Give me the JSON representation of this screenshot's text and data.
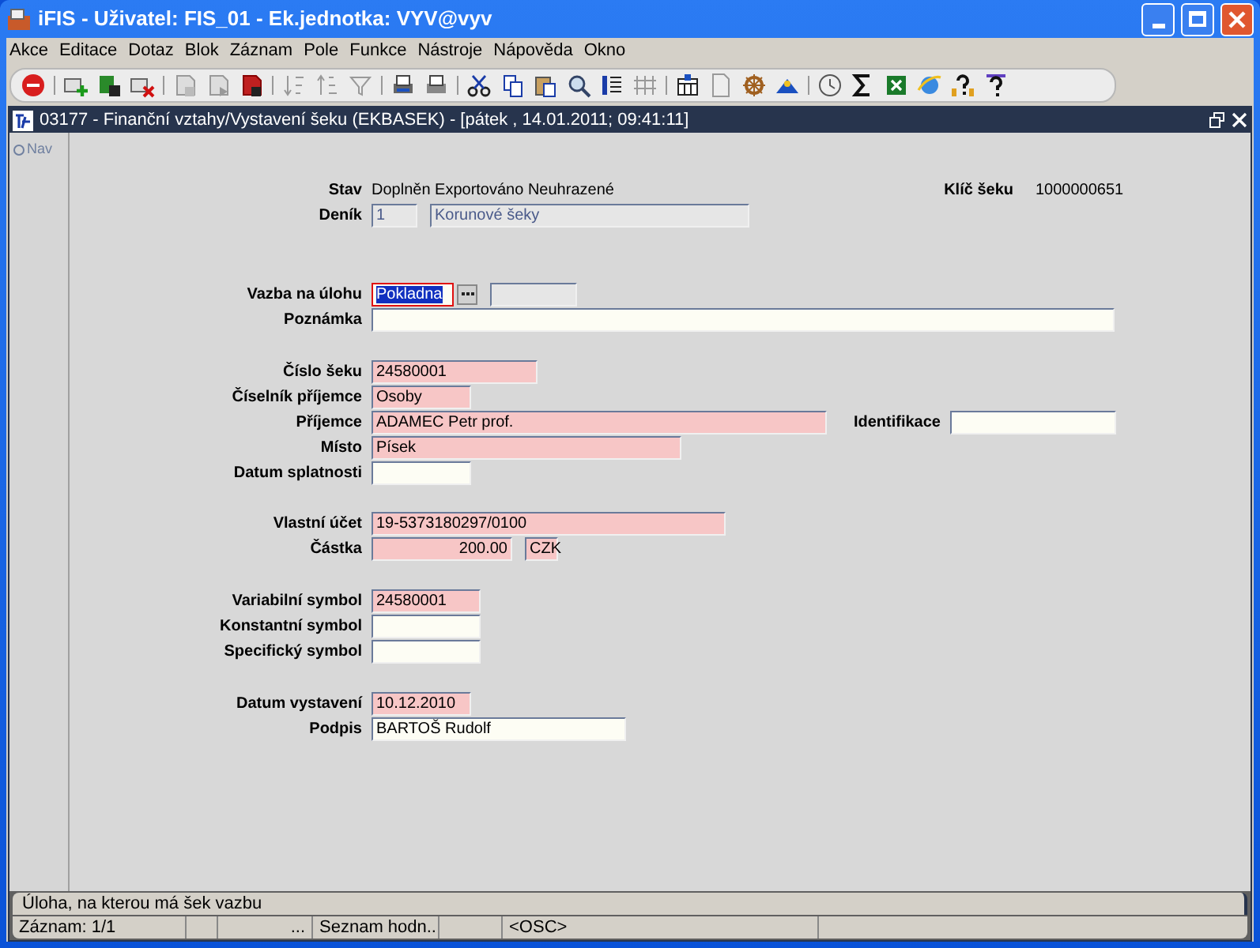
{
  "window": {
    "title": "iFIS - Uživatel: FIS_01 - Ek.jednotka: VYV@vyv"
  },
  "menu": [
    "Akce",
    "Editace",
    "Dotaz",
    "Blok",
    "Záznam",
    "Pole",
    "Funkce",
    "Nástroje",
    "Nápověda",
    "Okno"
  ],
  "frame": {
    "title": "03177 - Finanční vztahy/Vystavení šeku (EKBASEK) - [pátek  , 14.01.2011; 09:41:11]"
  },
  "nav": {
    "label": "Nav"
  },
  "form": {
    "rows": [
      {
        "kind": "status",
        "label": "Stav",
        "text": "Doplněn Exportováno Neuhrazené",
        "side_label": "Klíč šeku",
        "side_text": "1000000651"
      },
      {
        "kind": "fields",
        "label": "Deník",
        "fields": [
          {
            "kind": "text",
            "value": "1",
            "disabled": true,
            "focused": false
          },
          {
            "kind": "text",
            "value": "Korunové šeky",
            "disabled": true,
            "focused": false
          }
        ]
      },
      {
        "kind": "fields",
        "label": "Vazba na úlohu",
        "fields": [
          {
            "kind": "text",
            "value": "Pokladna",
            "required": false,
            "disabled": false,
            "focused": true
          },
          {
            "kind": "lookup"
          },
          {
            "kind": "text",
            "disabled": true,
            "focused": false
          }
        ]
      },
      {
        "kind": "fields",
        "label": "Poznámka",
        "fields": [
          {
            "kind": "text",
            "required": false,
            "disabled": false,
            "focused": false
          }
        ]
      },
      {
        "kind": "fields",
        "label": "Číslo šeku",
        "fields": [
          {
            "kind": "text",
            "value": "24580001",
            "required": true,
            "disabled": false,
            "focused": false
          }
        ]
      },
      {
        "kind": "fields",
        "label": "Číselník příjemce",
        "fields": [
          {
            "kind": "text",
            "value": "Osoby",
            "required": true,
            "disabled": false,
            "focused": false
          }
        ]
      },
      {
        "kind": "fields",
        "label": "Příjemce",
        "fields": [
          {
            "kind": "text",
            "value": "ADAMEC Petr prof.",
            "required": true,
            "disabled": false,
            "focused": false
          }
        ],
        "side_label": "Identifikace",
        "side_field": {
          "kind": "text",
          "required": false,
          "disabled": false,
          "focused": false
        }
      },
      {
        "kind": "fields",
        "label": "Místo",
        "fields": [
          {
            "kind": "text",
            "value": "Písek",
            "required": true,
            "disabled": false,
            "focused": false
          }
        ]
      },
      {
        "kind": "fields",
        "label": "Datum splatnosti",
        "fields": [
          {
            "kind": "text",
            "required": false,
            "disabled": false,
            "focused": false
          }
        ]
      },
      {
        "kind": "fields",
        "label": "Vlastní účet",
        "fields": [
          {
            "kind": "text",
            "value": "19-5373180297/0100",
            "required": true,
            "disabled": false,
            "focused": false
          }
        ]
      },
      {
        "kind": "fields",
        "label": "Částka",
        "fields": [
          {
            "kind": "amount",
            "value": "200.00",
            "required": true,
            "disabled": false,
            "focused": false
          },
          {
            "kind": "text",
            "value": "CZK",
            "required": true,
            "disabled": false,
            "focused": false
          }
        ]
      },
      {
        "kind": "fields",
        "label": "Variabilní symbol",
        "fields": [
          {
            "kind": "text",
            "value": "24580001",
            "required": true,
            "disabled": false,
            "focused": false
          }
        ]
      },
      {
        "kind": "fields",
        "label": "Konstantní symbol",
        "fields": [
          {
            "kind": "text",
            "required": false,
            "disabled": false,
            "focused": false
          }
        ]
      },
      {
        "kind": "fields",
        "label": "Specifický symbol",
        "fields": [
          {
            "kind": "text",
            "required": false,
            "disabled": false,
            "focused": false
          }
        ]
      },
      {
        "kind": "fields",
        "label": "Datum vystavení",
        "fields": [
          {
            "kind": "text",
            "value": "10.12.2010",
            "required": true,
            "disabled": false,
            "focused": false
          }
        ]
      },
      {
        "kind": "fields",
        "label": "Podpis",
        "fields": [
          {
            "kind": "text",
            "value": "BARTOŠ Rudolf",
            "required": false,
            "disabled": false,
            "focused": false
          }
        ]
      }
    ]
  },
  "status_bar": {
    "hint": "Úloha, na kterou má šek vazbu",
    "cells": [
      "Záznam: 1/1",
      null,
      "...",
      "Seznam hodn..",
      null,
      "<OSC>"
    ]
  }
}
